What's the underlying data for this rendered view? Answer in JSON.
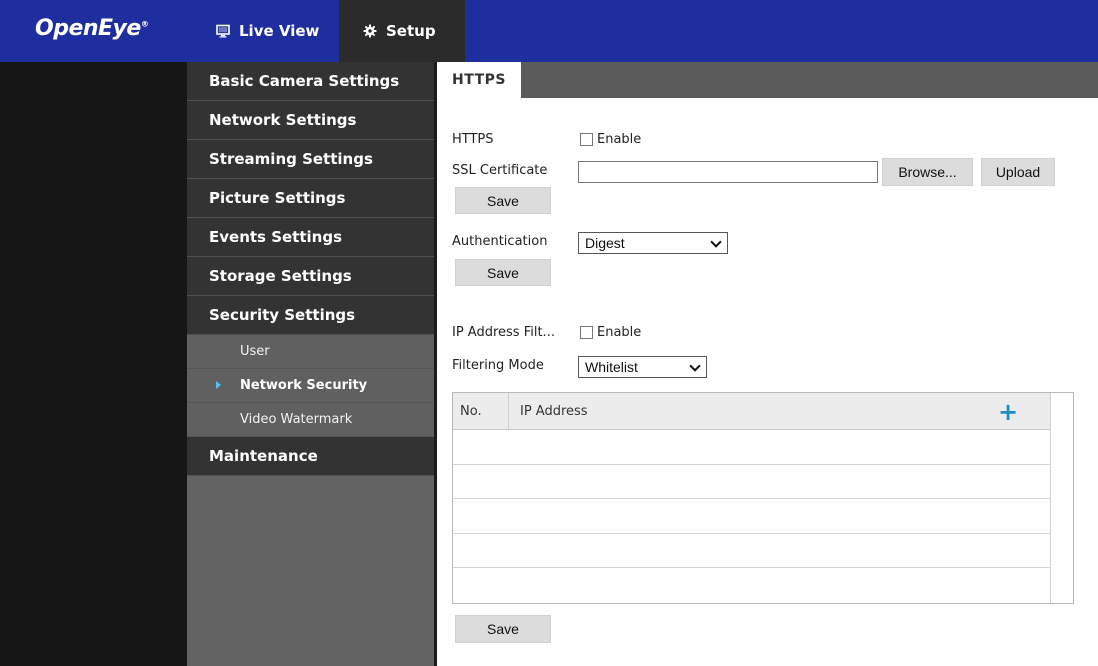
{
  "brand": {
    "logo": "OpenEye",
    "mark": "®"
  },
  "topnav": {
    "live_view": "Live View",
    "setup": "Setup"
  },
  "sidebar": {
    "items": [
      {
        "label": "Basic Camera Settings"
      },
      {
        "label": "Network Settings"
      },
      {
        "label": "Streaming Settings"
      },
      {
        "label": "Picture Settings"
      },
      {
        "label": "Events Settings"
      },
      {
        "label": "Storage Settings"
      },
      {
        "label": "Security Settings"
      },
      {
        "label": "Maintenance"
      }
    ],
    "security_sub": [
      {
        "label": "User"
      },
      {
        "label": "Network Security"
      },
      {
        "label": "Video Watermark"
      }
    ]
  },
  "main": {
    "tab": "HTTPS",
    "https_label": "HTTPS",
    "enable_label": "Enable",
    "ssl_label": "SSL Certificate",
    "ssl_value": "",
    "browse_label": "Browse...",
    "upload_label": "Upload",
    "save_label": "Save",
    "auth_label": "Authentication",
    "auth_value": "Digest",
    "ip_filter_label": "IP Address Filt...",
    "ip_filter_enable": "Enable",
    "filter_mode_label": "Filtering Mode",
    "filter_mode_value": "Whitelist",
    "table": {
      "col_no": "No.",
      "col_ip": "IP Address",
      "add_symbol": "+"
    }
  },
  "colors": {
    "topbar": "#1f2e9e",
    "accent_plus": "#1d8fc4",
    "sidebar_header": "#333333",
    "sidebar_sub": "#606060"
  }
}
